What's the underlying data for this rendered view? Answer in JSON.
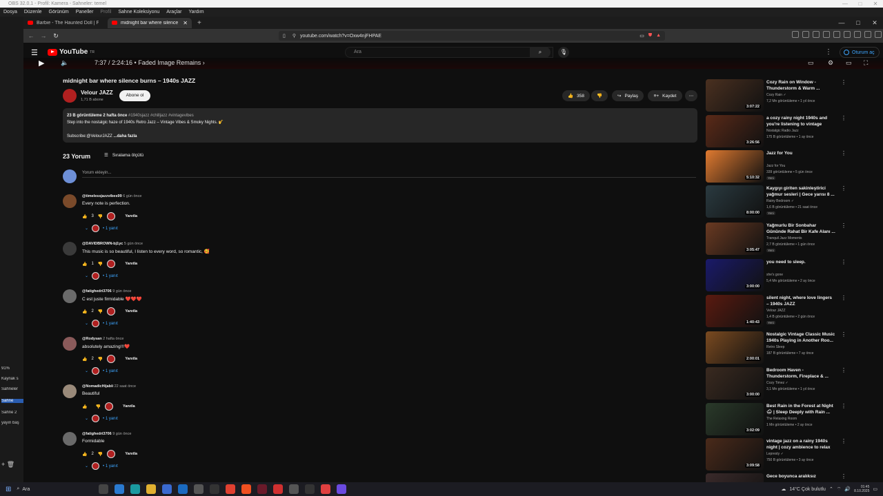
{
  "obs": {
    "title": "OBS 32.0.1 - Profil: Kamera - Sahneler: temel",
    "menu": [
      "Dosya",
      "Düzenle",
      "Görünüm",
      "Paneller",
      "Profil",
      "Sahne Koleksiyonu",
      "Araçlar",
      "Yardım"
    ],
    "left_rows": [
      "Kaynak s",
      "Sahneler",
      "Sahne",
      "Sahne 2",
      "yayın baş"
    ],
    "left_pct": "91%"
  },
  "browser": {
    "tabs": [
      {
        "label": "Barbie - The Haunted Doll | Full Horr"
      },
      {
        "label": "midnight bar where silence burn"
      }
    ],
    "url": "youtube.com/watch?v=Oxw4njFHPAE"
  },
  "yt": {
    "logo": "YouTube",
    "logo_sup": "TR",
    "search_placeholder": "Ara",
    "sign_in": "Oturum aç",
    "time_chapter": "7:37 / 2:24:16 • Faded Image Remains ›"
  },
  "video": {
    "title": "midnight bar where silence burns – 1940s JAZZ",
    "channel": "Velour JAZZ",
    "subscribers": "1,71 B abone",
    "subscribe": "Abone ol",
    "likes": "358",
    "share": "Paylaş",
    "save": "Kaydet",
    "desc_meta": "23 B görüntüleme  2 hafta önce",
    "desc_tags": "#1940sjazz #chilljazz #vintagevibes",
    "desc_line": "Step into the nostalgic haze of 1940s Retro Jazz – Vintage Vibes & Smoky Nights. 🎷",
    "desc_sub": "Subscribe:@VelourJAZZ",
    "desc_more": "...daha fazla"
  },
  "comments_section": {
    "count": "23 Yorum",
    "sort": "Sıralama ölçütü",
    "add": "Yorum ekleyin..."
  },
  "comments": [
    {
      "author": "@timelessjazzvibes99",
      "when": "6 gün önce",
      "text": "Every note is perfection.",
      "likes": "3",
      "reply": "Yanıtla",
      "replies": "1 yanıt",
      "avatar": "#7a4a2a"
    },
    {
      "author": "@DAVIDBROWN-bj1yc",
      "when": "5 gün önce",
      "text": "This music is so beautiful, I listen to every word, so romantic, 🥰",
      "likes": "1",
      "reply": "Yanıtla",
      "replies": "1 yanıt",
      "avatar": "#3a3a3a"
    },
    {
      "author": "@fatighedri3706",
      "when": "9 gün önce",
      "text": "C est juste firmidable ❤️❤️❤️",
      "likes": "2",
      "reply": "Yanıtla",
      "replies": "1 yanıt",
      "avatar": "#6a6a6a"
    },
    {
      "author": "@Rodysan",
      "when": "2 hafta önce",
      "text": "absolutely amazing!!!❤️",
      "likes": "2",
      "reply": "Yanıtla",
      "replies": "1 yanıt",
      "avatar": "#8a5a5a"
    },
    {
      "author": "@NomadicHijabii",
      "when": "22 saat önce",
      "text": "Beautiful",
      "likes": "",
      "reply": "Yanıtla",
      "replies": "1 yanıt",
      "avatar": "#9a8a7a"
    },
    {
      "author": "@fatighedri3706",
      "when": "9 gün önce",
      "text": "Formidable",
      "likes": "2",
      "reply": "Yanıtla",
      "replies": "1 yanıt",
      "avatar": "#6a6a6a"
    }
  ],
  "recommendations": [
    {
      "title": "Cozy Rain on Window - Thunderstorm & Warm ...",
      "channel": "Cozy Rain ✓",
      "views": "7,2 Mn görüntüleme • 1 yıl önce",
      "duration": "3:07:22",
      "new": "",
      "color": "#4a3020"
    },
    {
      "title": "a cozy rainy night 1940s and you're listening to vintage mus...",
      "channel": "Nostalgic Radio Jazz",
      "views": "175 B görüntüleme • 1 ay önce",
      "duration": "3:26:56",
      "new": "",
      "color": "#5a2a18"
    },
    {
      "title": "Jazz for You",
      "channel": "Jazz for You",
      "views": "339 görüntüleme • 5 gün önce",
      "duration": "5:10:32",
      "new": "Yeni",
      "color": "#e07a30"
    },
    {
      "title": "Kaygıyı giriten sakinleştirici yağmur sesleri | Gece yarısı 8 ...",
      "channel": "Rainy Bedroom ✓",
      "views": "1,6 B görüntüleme • 21 saat önce",
      "duration": "8:00:00",
      "new": "Yeni",
      "color": "#2a3a40"
    },
    {
      "title": "Yağmurlu Bir Sonbahar Gününde Rahat Bir Kafe Alanı ...",
      "channel": "Tranquil Jazz Moments",
      "views": "2,7 B görüntüleme • 1 gün önce",
      "duration": "3:05:47",
      "new": "Yeni",
      "color": "#6a3a22"
    },
    {
      "title": "you need to sleep.",
      "channel": "she's gone",
      "views": "5,4 Mn görüntüleme • 2 ay önce",
      "duration": "3:00:00",
      "new": "",
      "color": "#1a1a6a"
    },
    {
      "title": "silent night, where love lingers – 1940s JAZZ",
      "channel": "Velour JAZZ",
      "views": "1,4 B görüntüleme • 2 gün önce",
      "duration": "1:40:43",
      "new": "Yeni",
      "color": "#5a1a10"
    },
    {
      "title": "Nostalgic Vintage Classic Music 1940s Playing in Another Roo...",
      "channel": "Retro Sleep",
      "views": "187 B görüntüleme • 7 ay önce",
      "duration": "2:00:01",
      "new": "",
      "color": "#7a4a20"
    },
    {
      "title": "Bedroom Haven - Thunderstorm, Fireplace & ...",
      "channel": "Cozy Timez ✓",
      "views": "3,1 Mn görüntüleme • 1 yıl önce",
      "duration": "3:00:00",
      "new": "",
      "color": "#3a2a20"
    },
    {
      "title": "Best Rain in the Forest at Night 🌧 | Sleep Deeply with Rain ...",
      "channel": "The Relaxing Room",
      "views": "1 Mn görüntüleme • 2 ay önce",
      "duration": "3:02:09",
      "new": "",
      "color": "#2a3a2a"
    },
    {
      "title": "vintage jazz on a rainy 1940s night | cozy ambience to relax",
      "channel": "Lepresty ✓",
      "views": "750 B görüntüleme • 3 ay önce",
      "duration": "3:09:58",
      "new": "",
      "color": "#4a2a1a"
    },
    {
      "title": "Gece boyunca aralıksız",
      "channel": "",
      "views": "",
      "duration": "",
      "new": "",
      "color": "#3a2a2a"
    }
  ],
  "taskbar": {
    "search": "Ara",
    "weather": "14°C  Çok bulutlu",
    "time": "01:45",
    "date": "8.10.2025"
  }
}
